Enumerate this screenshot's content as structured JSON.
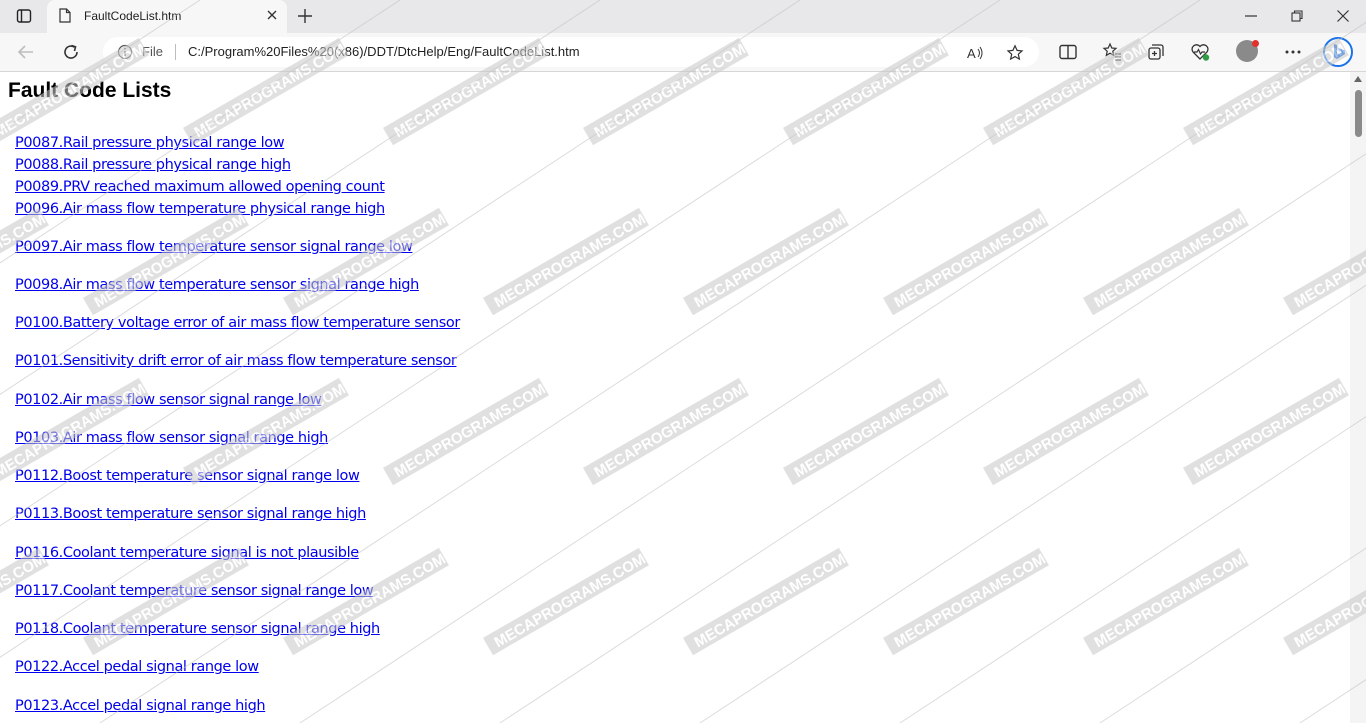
{
  "browser": {
    "tab_title": "FaultCodeList.htm",
    "address_scheme_label": "File",
    "url": "C:/Program%20Files%20(x86)/DDT/DtcHelp/Eng/FaultCodeList.htm"
  },
  "page": {
    "title": "Fault Code Lists",
    "fault_codes": [
      {
        "label": "P0087.Rail pressure physical range low"
      },
      {
        "label": "P0088.Rail pressure physical range high"
      },
      {
        "label": "P0089.PRV reached maximum allowed opening count"
      },
      {
        "label": "P0096.Air mass flow temperature physical range high"
      },
      {
        "label": "P0097.Air mass flow temperature sensor signal range low"
      },
      {
        "label": "P0098.Air mass flow temperature sensor signal range high"
      },
      {
        "label": "P0100.Battery voltage error of air mass flow temperature sensor"
      },
      {
        "label": "P0101.Sensitivity drift error of air mass flow temperature sensor"
      },
      {
        "label": "P0102.Air mass flow sensor signal range low"
      },
      {
        "label": "P0103.Air mass flow sensor signal range high"
      },
      {
        "label": "P0112.Boost temperature sensor signal range low"
      },
      {
        "label": "P0113.Boost temperature sensor signal range high"
      },
      {
        "label": "P0116.Coolant temperature signal is not plausible"
      },
      {
        "label": "P0117.Coolant temperature sensor signal range low"
      },
      {
        "label": "P0118.Coolant temperature sensor signal range high"
      },
      {
        "label": "P0122.Accel pedal signal range low"
      },
      {
        "label": "P0123.Accel pedal signal range high"
      }
    ]
  },
  "watermark": {
    "text": "MECAPROGRAMS.COM"
  },
  "colors": {
    "link": "#0000ee",
    "tab_strip": "#e8e8ea",
    "toolbar": "#f7f7f7"
  },
  "icons": [
    "tab-actions-icon",
    "page-icon",
    "close-icon",
    "plus-icon",
    "minimize-icon",
    "restore-icon",
    "back-icon",
    "refresh-icon",
    "info-icon",
    "read-aloud-icon",
    "star-icon",
    "split-screen-icon",
    "favorites-icon",
    "collections-icon",
    "browser-essentials-icon",
    "more-icon",
    "bing-icon"
  ]
}
